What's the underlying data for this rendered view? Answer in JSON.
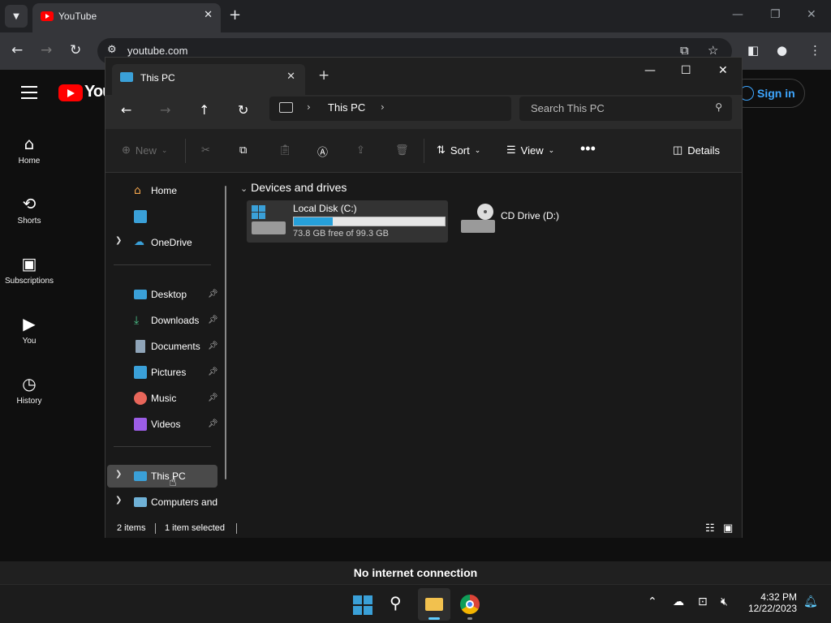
{
  "browser": {
    "tab_title": "YouTube",
    "url": "youtube.com"
  },
  "youtube": {
    "logo_text": "You",
    "nav": [
      {
        "label": "Home",
        "icon": "home-icon"
      },
      {
        "label": "Shorts",
        "icon": "shorts-icon"
      },
      {
        "label": "Subscriptions",
        "icon": "subscriptions-icon"
      },
      {
        "label": "You",
        "icon": "you-icon"
      },
      {
        "label": "History",
        "icon": "history-icon"
      }
    ],
    "sign_in": "Sign in",
    "banner": "No internet connection"
  },
  "explorer": {
    "tab_title": "This PC",
    "breadcrumb": "This PC",
    "search_placeholder": "Search This PC",
    "commands": {
      "new": "New",
      "sort": "Sort",
      "view": "View",
      "details": "Details"
    },
    "nav_items": [
      {
        "label": "Home",
        "icon": "home-icon"
      },
      {
        "label": "",
        "icon": "gallery-icon"
      },
      {
        "label": "OneDrive",
        "icon": "onedrive-icon"
      },
      {
        "label": "Desktop",
        "icon": "desktop-icon",
        "pinned": true
      },
      {
        "label": "Downloads",
        "icon": "downloads-icon",
        "pinned": true
      },
      {
        "label": "Documents",
        "icon": "documents-icon",
        "pinned": true
      },
      {
        "label": "Pictures",
        "icon": "pictures-icon",
        "pinned": true
      },
      {
        "label": "Music",
        "icon": "music-icon",
        "pinned": true
      },
      {
        "label": "Videos",
        "icon": "videos-icon",
        "pinned": true
      },
      {
        "label": "This PC",
        "icon": "this-pc-icon",
        "selected": true
      },
      {
        "label": "Computers and",
        "icon": "network-icon"
      }
    ],
    "group_header": "Devices and drives",
    "drives": [
      {
        "name": "Local Disk (C:)",
        "free_text": "73.8 GB free of 99.3 GB",
        "used_fraction": 0.257
      },
      {
        "name": "CD Drive (D:)"
      }
    ],
    "status": {
      "items": "2 items",
      "selected": "1 item selected"
    }
  },
  "taskbar": {
    "time": "4:32 PM",
    "date": "12/22/2023"
  },
  "colors": {
    "accent": "#3aa0d8",
    "youtube_red": "#ff0000",
    "link_blue": "#3ea6ff"
  }
}
